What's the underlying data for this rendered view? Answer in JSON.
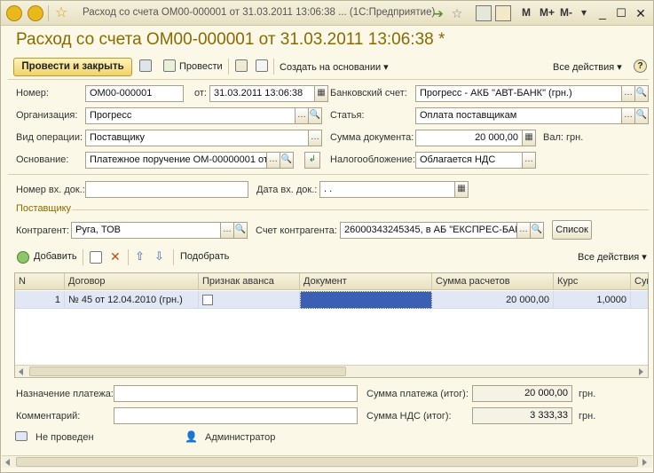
{
  "titlebar": {
    "title": "Расход со счета ОМ00-000001 от 31.03.2011 13:06:38 ...  (1С:Предприятие)",
    "m_label": "M",
    "mplus_label": "M+",
    "mminus_label": "M-"
  },
  "heading": "Расход со счета ОМ00-000001 от 31.03.2011 13:06:38 *",
  "toolbar": {
    "post_close": "Провести и закрыть",
    "post": "Провести",
    "create_based_on": "Создать на основании ▾",
    "all_actions": "Все действия ▾",
    "help": "?"
  },
  "form": {
    "number_label": "Номер:",
    "number_value": "ОМ00-000001",
    "from_label": "от:",
    "date_value": "31.03.2011 13:06:38",
    "bank_account_label": "Банковский счет:",
    "bank_account_value": "Прогресс - АКБ \"АВТ-БАНК\" (грн.)",
    "org_label": "Организация:",
    "org_value": "Прогресс",
    "article_label": "Статья:",
    "article_value": "Оплата поставщикам",
    "op_type_label": "Вид операции:",
    "op_type_value": "Поставщику",
    "doc_sum_label": "Сумма документа:",
    "doc_sum_value": "20 000,00",
    "currency_label": "Вал: грн.",
    "basis_label": "Основание:",
    "basis_value": "Платежное поручение ОМ-00000001 от",
    "taxation_label": "Налогообложение:",
    "taxation_value": "Облагается НДС",
    "in_doc_number_label": "Номер вх. док.:",
    "in_doc_number_value": "",
    "in_doc_date_label": "Дата вх. док.:",
    "in_doc_date_value": " .  .",
    "supplier_section": "Поставщику",
    "counterparty_label": "Контрагент:",
    "counterparty_value": "Руга, ТОВ",
    "counterparty_account_label": "Счет контрагента:",
    "counterparty_account_value": "26000343245345, в АБ \"ЕКСПРЕС-БАН",
    "list_button": "Список"
  },
  "table_toolbar": {
    "add": "Добавить",
    "pick": "Подобрать",
    "all_actions": "Все действия ▾"
  },
  "table": {
    "headers": [
      "N",
      "Договор",
      "Признак аванса",
      "Документ",
      "Сумма расчетов",
      "Курс",
      "Сум"
    ],
    "rows": [
      {
        "n": "1",
        "contract": "№ 45 от 12.04.2010 (грн.)",
        "advance": false,
        "document": "",
        "sum": "20 000,00",
        "rate": "1,0000"
      }
    ]
  },
  "footer": {
    "purpose_label": "Назначение платежа:",
    "purpose_value": "",
    "comment_label": "Комментарий:",
    "comment_value": "",
    "payment_total_label": "Сумма платежа (итог):",
    "payment_total_value": "20 000,00",
    "payment_currency": "грн.",
    "vat_total_label": "Сумма НДС (итог):",
    "vat_total_value": "3 333,33",
    "vat_currency": "грн.",
    "status": "Не проведен",
    "user": "Администратор"
  }
}
